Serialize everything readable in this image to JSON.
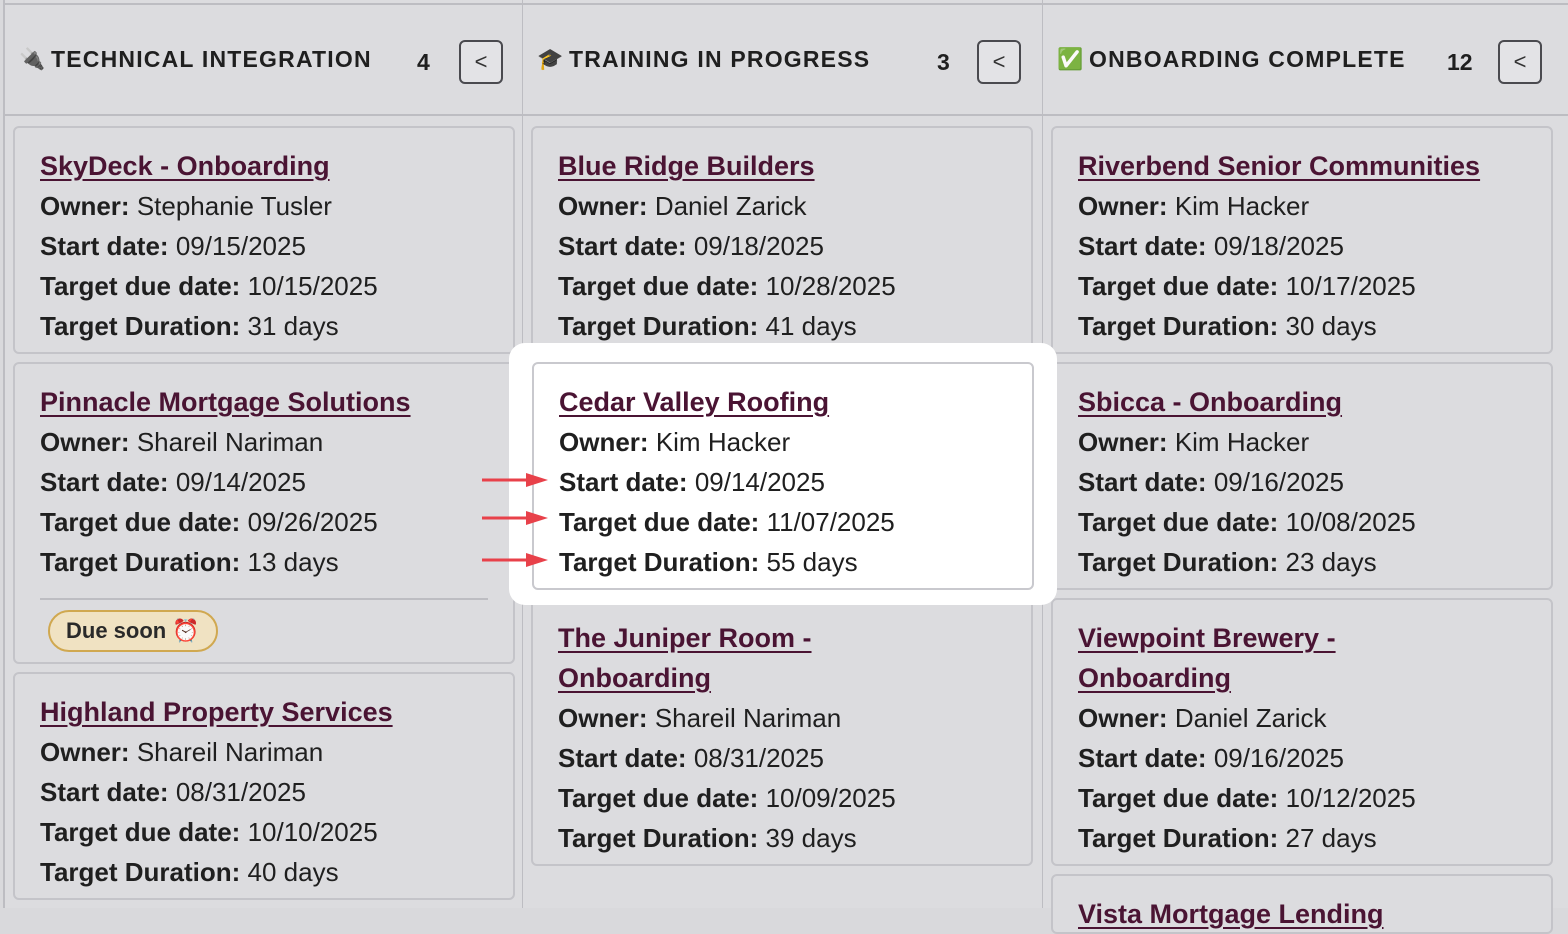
{
  "columns": [
    {
      "title": "TECHNICAL INTEGRATION",
      "icon": "🔌",
      "count": "4",
      "cards": [
        {
          "title": "SkyDeck - Onboarding",
          "owner": "Stephanie Tusler",
          "start": "09/15/2025",
          "due": "10/15/2025",
          "duration": "31 days"
        },
        {
          "title": "Pinnacle Mortgage Solutions",
          "owner": "Shareil Nariman",
          "start": "09/14/2025",
          "due": "09/26/2025",
          "duration": "13 days",
          "badge": "Due soon ⏰"
        },
        {
          "title": "Highland Property Services",
          "owner": "Shareil Nariman",
          "start": "08/31/2025",
          "due": "10/10/2025",
          "duration": "40 days"
        }
      ]
    },
    {
      "title": "TRAINING IN PROGRESS",
      "icon": "🎓",
      "count": "3",
      "cards": [
        {
          "title": "Blue Ridge Builders",
          "owner": "Daniel Zarick",
          "start": "09/18/2025",
          "due": "10/28/2025",
          "duration": "41 days"
        },
        {
          "title": "Cedar Valley Roofing",
          "owner": "Kim Hacker",
          "start": "09/14/2025",
          "due": "11/07/2025",
          "duration": "55 days"
        },
        {
          "title": "The Juniper Room - Onboarding",
          "title_line1": "The Juniper Room -",
          "title_line2": "Onboarding",
          "owner": "Shareil Nariman",
          "start": "08/31/2025",
          "due": "10/09/2025",
          "duration": "39 days"
        }
      ]
    },
    {
      "title": "ONBOARDING COMPLETE",
      "icon": "✅",
      "count": "12",
      "cards": [
        {
          "title": "Riverbend Senior Communities",
          "owner": "Kim Hacker",
          "start": "09/18/2025",
          "due": "10/17/2025",
          "duration": "30 days"
        },
        {
          "title": "Sbicca - Onboarding",
          "owner": "Kim Hacker",
          "start": "09/16/2025",
          "due": "10/08/2025",
          "duration": "23 days"
        },
        {
          "title": "Viewpoint Brewery - Onboarding",
          "title_line1": "Viewpoint Brewery -",
          "title_line2": "Onboarding",
          "owner": "Daniel Zarick",
          "start": "09/16/2025",
          "due": "10/12/2025",
          "duration": "27 days"
        },
        {
          "title": "Vista Mortgage Lending"
        }
      ]
    }
  ],
  "labels": {
    "owner": "Owner:",
    "start": "Start date:",
    "due": "Target due date:",
    "duration": "Target Duration:"
  },
  "collapse_glyph": "<",
  "colors": {
    "link": "#4a1433",
    "arrow": "#e8414a",
    "badge_bg": "#f0e2c2",
    "badge_border": "#d0a850"
  }
}
